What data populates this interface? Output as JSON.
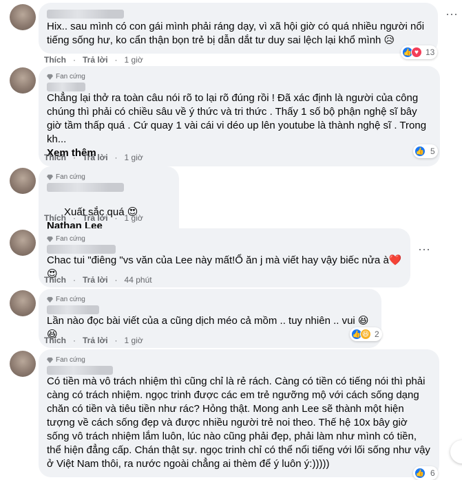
{
  "comments": [
    {
      "text": "Hix.. sau mình có con gái mình phải ráng dạy, vì xã hội giờ có quá nhiều người nổi tiếng sống hư, ko cẩn thận bọn trẻ bị dẫn dắt tư duy sai lệch lại khổ mình 😥",
      "like_label": "Thích",
      "reply_label": "Trả lời",
      "time": "1 giờ",
      "reaction_count": "13"
    },
    {
      "badge": "Fan cứng",
      "text": "Chẳng lại thở ra toàn câu nói rõ to lại rõ đúng rồi ! Đã xác định là người của công chúng thì phải có chiều sâu về ý thức và tri thức . Thấy 1 số bộ phận nghệ sĩ bây giờ tầm thấp quá . Cứ quay 1 vài cái vi déo up lên youtube là thành nghệ sĩ . Trong kh...",
      "see_more": "Xem thêm",
      "like_label": "Thích",
      "reply_label": "Trả lời",
      "time": "1 giờ",
      "reaction_count": "5"
    },
    {
      "badge": "Fan cứng",
      "text": "Xuất sắc quá 😍",
      "tagged_name": "Nathan Lee",
      "like_label": "Thích",
      "reply_label": "Trả lời",
      "time": "1 giờ"
    },
    {
      "badge": "Fan cứng",
      "text": "Chac tui \"điêng \"vs văn của Lee này mất!Ổ ăn j mà viết hay vậy biếc nửa à❤️😍",
      "like_label": "Thích",
      "reply_label": "Trả lời",
      "time": "44 phút"
    },
    {
      "badge": "Fan cứng",
      "text": "Lần nào đọc bài viết của a cũng dịch méo cả mồm .. tuy nhiên .. vui 😆😆",
      "like_label": "Thích",
      "reply_label": "Trả lời",
      "time": "1 giờ",
      "reaction_count": "2"
    },
    {
      "badge": "Fan cứng",
      "text": "Có tiền mà vô trách nhiệm thì cũng chỉ là rẻ rách. Càng có tiền có tiếng nói thì phải càng có trách nhiệm. ngọc trinh được các em trẻ ngưỡng mộ với cách sống dạng chăn có tiền và tiêu tiền như rác? Hỏng thật. Mong anh Lee sẽ thành một hiện tượng về cách sống đẹp và được nhiều người trẻ noi theo. Thế hệ 10x bây giờ sống vô trách nhiệm lắm luôn, lúc nào cũng phải đẹp, phải làm như mình có tiền, thể hiện đẳng cấp. Chán thật sự. ngọc trinh chỉ có thể nổi tiếng với lối sống như vậy ở Việt Nam thôi, ra nước ngoài chẳng ai thèm để ý luôn ý:)))))",
      "reaction_count": "6"
    }
  ],
  "colors": {
    "bubble": "#f0f2f5",
    "meta": "#65676b",
    "like": "#1877f2",
    "love": "#f33e58",
    "haha": "#f7b125"
  }
}
